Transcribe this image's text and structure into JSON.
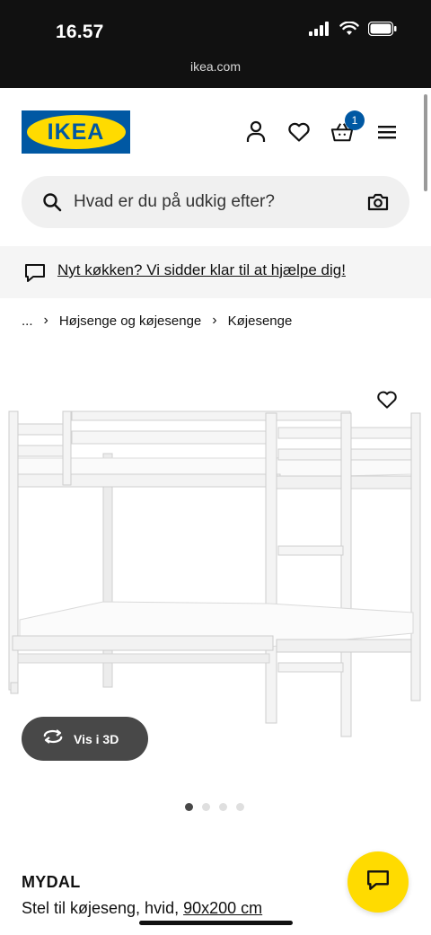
{
  "status_bar": {
    "time": "16.57",
    "url": "ikea.com"
  },
  "header": {
    "logo_text": "IKEA",
    "cart_count": "1",
    "colors": {
      "brand_blue": "#0058a3",
      "brand_yellow": "#ffdb00"
    },
    "icons": [
      "person-icon",
      "heart-icon",
      "basket-icon",
      "menu-icon"
    ]
  },
  "search": {
    "placeholder": "Hvad er du på udkig efter?"
  },
  "notice": {
    "text": "Nyt køkken? Vi sidder klar til at hjælpe dig!"
  },
  "breadcrumb": {
    "items": [
      "...",
      "Højsenge og køjesenge",
      "Køjesenge"
    ]
  },
  "gallery": {
    "view_3d_label": "Vis i 3D",
    "dots_total": 4,
    "active_dot": 1
  },
  "product": {
    "name": "MYDAL",
    "description": "Stel til køjeseng, hvid,",
    "size": "90x200 cm"
  }
}
